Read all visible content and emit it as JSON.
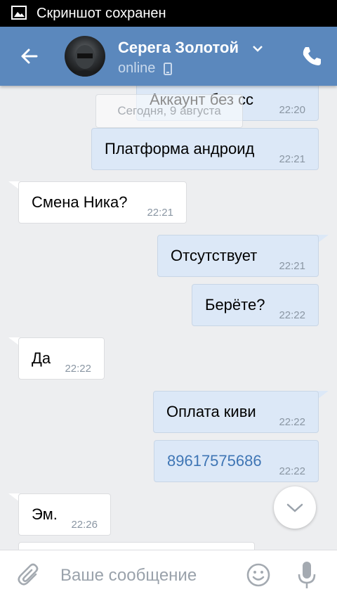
{
  "status_bar": {
    "text": "Скриншот сохранен"
  },
  "header": {
    "contact_name": "Серега Золотой",
    "presence": "online"
  },
  "chat": {
    "date_separator": "Сегодня, 9 августа",
    "messages": [
      {
        "direction": "out",
        "text": "Аккаунт без сс",
        "time": "22:20"
      },
      {
        "direction": "out",
        "text": "Платформа андроид",
        "time": "22:21"
      },
      {
        "direction": "in",
        "text": "Смена Ника?",
        "time": "22:21"
      },
      {
        "direction": "out",
        "text": "Отсутствует",
        "time": "22:21"
      },
      {
        "direction": "out",
        "text": "Берёте?",
        "time": "22:22"
      },
      {
        "direction": "in",
        "text": "Да",
        "time": "22:22"
      },
      {
        "direction": "out",
        "text": "Оплата киви",
        "time": "22:22"
      },
      {
        "direction": "out",
        "text": "89617575686",
        "time": "22:22",
        "is_link": true
      },
      {
        "direction": "in",
        "text": "Эм.",
        "time": "22:26"
      }
    ]
  },
  "composer": {
    "placeholder": "Ваше сообщение"
  },
  "colors": {
    "header": "#5b88bd",
    "outgoing_bubble": "#dce8f7",
    "incoming_bubble": "#ffffff",
    "link": "#3f76b5"
  },
  "icons": [
    "image-icon",
    "back-arrow-icon",
    "chevron-down-icon",
    "phone-device-icon",
    "call-icon",
    "chevron-down-icon",
    "paperclip-icon",
    "emoji-icon",
    "microphone-icon"
  ]
}
